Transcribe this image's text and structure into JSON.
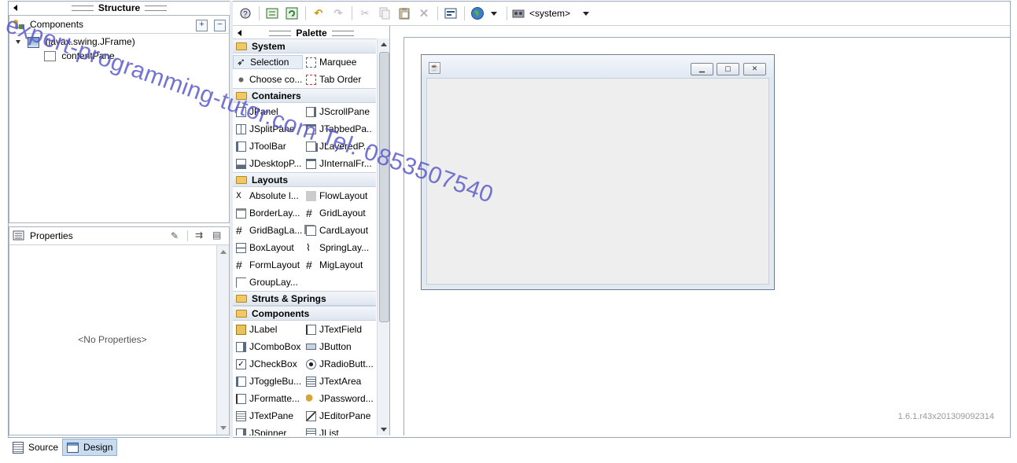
{
  "structure": {
    "title": "Structure",
    "components_header": "Components",
    "tree": [
      {
        "label": "(javax.swing.JFrame)",
        "level": 0
      },
      {
        "label": "contentPane",
        "level": 1
      }
    ]
  },
  "properties": {
    "header": "Properties",
    "empty_text": "<No Properties>"
  },
  "palette": {
    "title": "Palette",
    "categories": [
      {
        "name": "System",
        "items": [
          "Selection",
          "Marquee",
          "Choose co...",
          "Tab Order"
        ]
      },
      {
        "name": "Containers",
        "items": [
          "JPanel",
          "JScrollPane",
          "JSplitPane",
          "JTabbedPa...",
          "JToolBar",
          "JLayeredP...",
          "JDesktopP...",
          "JInternalFr..."
        ]
      },
      {
        "name": "Layouts",
        "items": [
          "Absolute l...",
          "FlowLayout",
          "BorderLay...",
          "GridLayout",
          "GridBagLa...",
          "CardLayout",
          "BoxLayout",
          "SpringLay...",
          "FormLayout",
          "MigLayout",
          "GroupLay..."
        ]
      },
      {
        "name": "Struts & Springs",
        "items": []
      },
      {
        "name": "Components",
        "items": [
          "JLabel",
          "JTextField",
          "JComboBox",
          "JButton",
          "JCheckBox",
          "JRadioButt...",
          "JToggleBu...",
          "JTextArea",
          "JFormatte...",
          "JPassword...",
          "JTextPane",
          "JEditorPane",
          "JSpinner",
          "JList"
        ]
      }
    ]
  },
  "toolbar": {
    "system_combo": "<system>"
  },
  "design": {
    "version": "1.6.1.r43x201309092314"
  },
  "tabs": {
    "source": "Source",
    "design": "Design"
  },
  "watermark": {
    "line1": "expert-programming-tutor.com Tel. 0853507540"
  }
}
